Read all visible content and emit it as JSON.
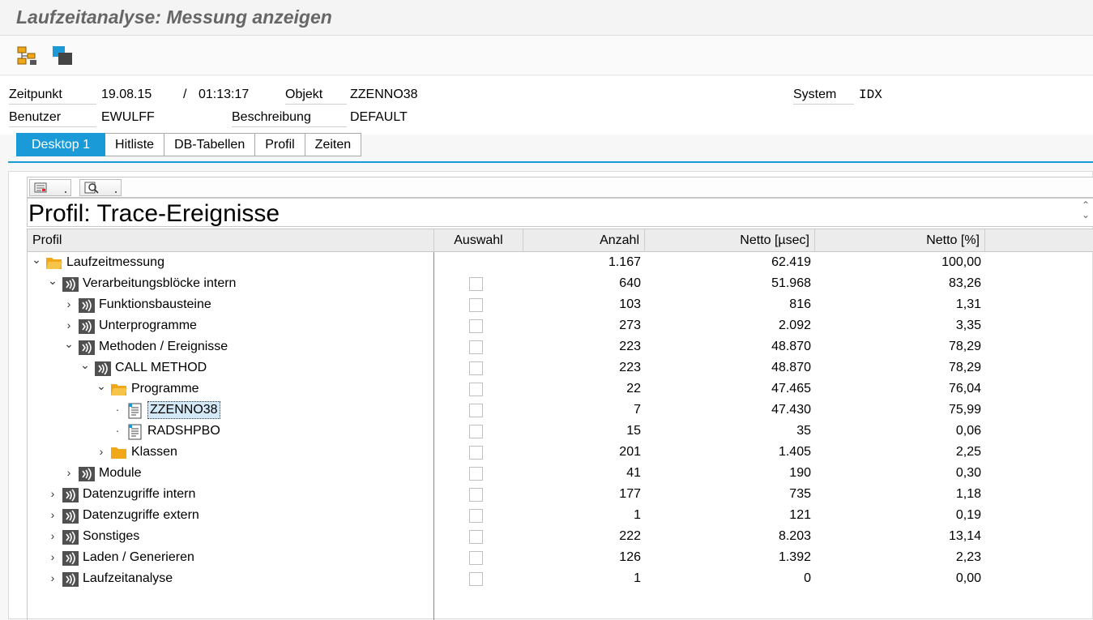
{
  "window": {
    "title": "Laufzeitanalyse: Messung anzeigen"
  },
  "toolbar": {
    "icons": [
      "hierarchy-icon",
      "windows-icon"
    ]
  },
  "header": {
    "zeitpunkt_label": "Zeitpunkt",
    "zeitpunkt_date": "19.08.15",
    "zeitpunkt_sep": "/",
    "zeitpunkt_time": "01:13:17",
    "objekt_label": "Objekt",
    "objekt_value": "ZZENNO38",
    "system_label": "System",
    "system_value": "IDX",
    "benutzer_label": "Benutzer",
    "benutzer_value": "EWULFF",
    "beschreibung_label": "Beschreibung",
    "beschreibung_value": "DEFAULT"
  },
  "tabs": [
    {
      "label": "Desktop 1",
      "active": true
    },
    {
      "label": "Hitliste",
      "active": false
    },
    {
      "label": "DB-Tabellen",
      "active": false
    },
    {
      "label": "Profil",
      "active": false
    },
    {
      "label": "Zeiten",
      "active": false
    }
  ],
  "banner": {
    "text": "Profil: Trace-Ereignisse"
  },
  "grid": {
    "columns": {
      "profil": "Profil",
      "auswahl": "Auswahl",
      "anzahl": "Anzahl",
      "netto_usec": "Netto [µsec]",
      "netto_pct": "Netto [%]"
    },
    "rows": [
      {
        "label": "Laufzeitmessung",
        "level": 0,
        "node": "expanded",
        "icon": "folder-open-icon",
        "checkbox": false,
        "anzahl": "1.167",
        "netto_usec": "62.419",
        "netto_pct": "100,00"
      },
      {
        "label": "Verarbeitungsblöcke intern",
        "level": 1,
        "node": "expanded",
        "icon": "component-icon",
        "checkbox": true,
        "anzahl": "640",
        "netto_usec": "51.968",
        "netto_pct": "83,26"
      },
      {
        "label": "Funktionsbausteine",
        "level": 2,
        "node": "collapsed",
        "icon": "component-icon",
        "checkbox": true,
        "anzahl": "103",
        "netto_usec": "816",
        "netto_pct": "1,31"
      },
      {
        "label": "Unterprogramme",
        "level": 2,
        "node": "collapsed",
        "icon": "component-icon",
        "checkbox": true,
        "anzahl": "273",
        "netto_usec": "2.092",
        "netto_pct": "3,35"
      },
      {
        "label": "Methoden / Ereignisse",
        "level": 2,
        "node": "expanded",
        "icon": "component-icon",
        "checkbox": true,
        "anzahl": "223",
        "netto_usec": "48.870",
        "netto_pct": "78,29"
      },
      {
        "label": "CALL METHOD",
        "level": 3,
        "node": "expanded",
        "icon": "component-icon",
        "checkbox": true,
        "anzahl": "223",
        "netto_usec": "48.870",
        "netto_pct": "78,29"
      },
      {
        "label": "Programme",
        "level": 4,
        "node": "expanded",
        "icon": "folder-open-icon",
        "checkbox": true,
        "anzahl": "22",
        "netto_usec": "47.465",
        "netto_pct": "76,04"
      },
      {
        "label": "ZZENNO38",
        "level": 5,
        "node": "leaf",
        "icon": "document-icon",
        "checkbox": true,
        "selected": true,
        "anzahl": "7",
        "netto_usec": "47.430",
        "netto_pct": "75,99"
      },
      {
        "label": "RADSHPBO",
        "level": 5,
        "node": "leaf",
        "icon": "document-icon",
        "checkbox": true,
        "anzahl": "15",
        "netto_usec": "35",
        "netto_pct": "0,06"
      },
      {
        "label": "Klassen",
        "level": 4,
        "node": "collapsed",
        "icon": "folder-icon",
        "checkbox": true,
        "anzahl": "201",
        "netto_usec": "1.405",
        "netto_pct": "2,25"
      },
      {
        "label": "Module",
        "level": 2,
        "node": "collapsed",
        "icon": "component-icon",
        "checkbox": true,
        "anzahl": "41",
        "netto_usec": "190",
        "netto_pct": "0,30"
      },
      {
        "label": "Datenzugriffe intern",
        "level": 1,
        "node": "collapsed",
        "icon": "component-icon",
        "checkbox": true,
        "anzahl": "177",
        "netto_usec": "735",
        "netto_pct": "1,18"
      },
      {
        "label": "Datenzugriffe extern",
        "level": 1,
        "node": "collapsed",
        "icon": "component-icon",
        "checkbox": true,
        "anzahl": "1",
        "netto_usec": "121",
        "netto_pct": "0,19"
      },
      {
        "label": "Sonstiges",
        "level": 1,
        "node": "collapsed",
        "icon": "component-icon",
        "checkbox": true,
        "anzahl": "222",
        "netto_usec": "8.203",
        "netto_pct": "13,14"
      },
      {
        "label": "Laden / Generieren",
        "level": 1,
        "node": "collapsed",
        "icon": "component-icon",
        "checkbox": true,
        "anzahl": "126",
        "netto_usec": "1.392",
        "netto_pct": "2,23"
      },
      {
        "label": "Laufzeitanalyse",
        "level": 1,
        "node": "collapsed",
        "icon": "component-icon",
        "checkbox": true,
        "anzahl": "1",
        "netto_usec": "0",
        "netto_pct": "0,00"
      }
    ]
  },
  "colors": {
    "accent": "#1a9bd7",
    "folder": "#f0a818",
    "selection": "#d3e9f8"
  }
}
